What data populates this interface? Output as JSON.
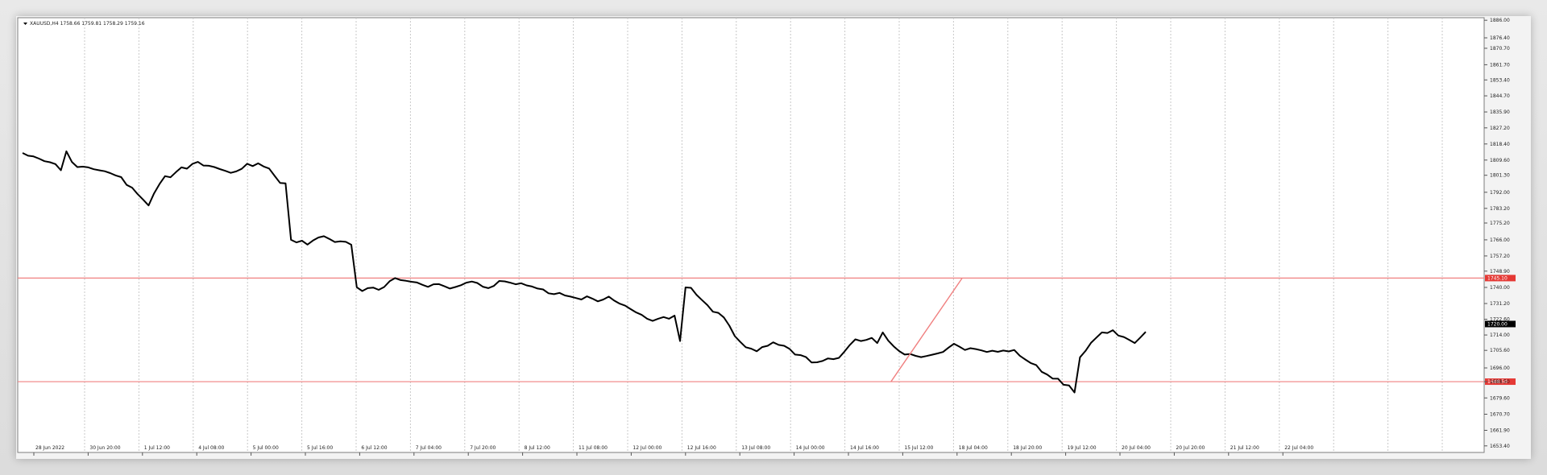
{
  "chart_data": {
    "type": "candlestick",
    "symbol_info": "XAUUSD,H4 1758.66 1759.81 1758.29 1759.16",
    "ylim": [
      1649.8,
      1887.4
    ],
    "y_tick_labels": [
      "1886.00",
      "1876.40",
      "1870.70",
      "1861.70",
      "1853.40",
      "1844.70",
      "1835.90",
      "1827.20",
      "1818.40",
      "1809.60",
      "1801.30",
      "1792.00",
      "1783.20",
      "1775.20",
      "1766.00",
      "1757.20",
      "1748.90",
      "1740.00",
      "1731.20",
      "1722.60",
      "1714.00",
      "1705.60",
      "1696.00",
      "1688.50",
      "1679.60",
      "1670.70",
      "1661.90",
      "1653.40"
    ],
    "x_tick_labels": [
      "28 Jun 2022",
      "30 Jun 20:00",
      "1 Jul 12:00",
      "4 Jul 08:00",
      "5 Jul 00:00",
      "5 Jul 16:00",
      "6 Jul 12:00",
      "7 Jul 04:00",
      "7 Jul 20:00",
      "8 Jul 12:00",
      "11 Jul 08:00",
      "12 Jul 00:00",
      "12 Jul 16:00",
      "13 Jul 08:00",
      "14 Jul 00:00",
      "14 Jul 16:00",
      "15 Jul 12:00",
      "18 Jul 04:00",
      "18 Jul 20:00",
      "19 Jul 12:00",
      "20 Jul 04:00",
      "20 Jul 20:00",
      "21 Jul 12:00",
      "22 Jul 04:00"
    ],
    "grid": true,
    "line_color": "#000000",
    "level_color": "#f08080",
    "tag_color": "#e53935",
    "current_tag_color": "#000000",
    "levels": [
      {
        "name": "upper",
        "price": 1745.1,
        "label": "1745.10"
      },
      {
        "name": "lower",
        "price": 1688.5,
        "label": "1688.50"
      }
    ],
    "current_price": {
      "price": 1720.0,
      "label": "1720.00"
    },
    "trendline": {
      "from": [
        158.5,
        1688.5
      ],
      "to": [
        171.5,
        1745.1
      ]
    },
    "series": [
      {
        "values": [
          1813.5,
          1812.0,
          1811.6,
          1810.4,
          1809.0,
          1808.4,
          1807.4,
          1804.0,
          1814.4,
          1808.6,
          1805.8,
          1806.0,
          1805.6,
          1804.6,
          1804.0,
          1803.5,
          1802.5,
          1801.2,
          1800.3,
          1796.0,
          1794.5,
          1791.0,
          1788.0,
          1784.8,
          1791.4,
          1796.5,
          1800.8,
          1800.2,
          1803.0,
          1805.6,
          1804.9,
          1807.5,
          1808.6,
          1806.6,
          1806.5,
          1805.8,
          1804.7,
          1803.7,
          1802.6,
          1803.4,
          1804.8,
          1807.6,
          1806.3,
          1807.8,
          1806.1,
          1805.0,
          1801.0,
          1797.1,
          1796.9,
          1766.0,
          1764.6,
          1765.5,
          1763.4,
          1765.6,
          1767.3,
          1768.0,
          1766.5,
          1764.8,
          1765.2,
          1764.9,
          1763.3,
          1740.1,
          1738.0,
          1739.6,
          1739.9,
          1738.7,
          1740.2,
          1743.4,
          1745.1,
          1744.0,
          1743.6,
          1743.1,
          1742.7,
          1741.4,
          1740.3,
          1741.7,
          1741.8,
          1740.6,
          1739.4,
          1740.2,
          1741.2,
          1742.6,
          1743.2,
          1742.4,
          1740.4,
          1739.6,
          1740.8,
          1743.5,
          1743.3,
          1742.6,
          1741.7,
          1742.3,
          1741.1,
          1740.5,
          1739.4,
          1738.9,
          1736.8,
          1736.3,
          1737.0,
          1735.6,
          1735.0,
          1734.2,
          1733.4,
          1735.1,
          1733.9,
          1732.4,
          1733.4,
          1735.0,
          1732.8,
          1731.1,
          1730.0,
          1728.1,
          1726.3,
          1725.0,
          1722.9,
          1721.7,
          1722.9,
          1723.8,
          1722.9,
          1724.6,
          1710.7,
          1740.0,
          1739.8,
          1736.0,
          1733.1,
          1730.3,
          1726.7,
          1726.1,
          1723.6,
          1719.1,
          1713.4,
          1710.2,
          1707.3,
          1706.5,
          1705.1,
          1707.4,
          1708.1,
          1710.0,
          1708.6,
          1708.1,
          1706.4,
          1703.3,
          1703.0,
          1701.9,
          1699.0,
          1699.1,
          1699.8,
          1701.2,
          1700.8,
          1701.5,
          1704.9,
          1708.6,
          1711.6,
          1710.7,
          1711.3,
          1712.4,
          1709.6,
          1715.4,
          1710.9,
          1707.8,
          1705.2,
          1703.3,
          1703.6,
          1702.6,
          1701.9,
          1702.5,
          1703.2,
          1703.9,
          1704.7,
          1707.1,
          1709.2,
          1707.6,
          1705.8,
          1706.8,
          1706.3,
          1705.6,
          1704.7,
          1705.4,
          1704.8,
          1705.5,
          1705.0,
          1705.8,
          1702.7,
          1700.6,
          1698.7,
          1697.6,
          1693.9,
          1692.4,
          1690.2,
          1690.1,
          1686.8,
          1686.4,
          1682.6,
          1701.8,
          1705.3,
          1709.7,
          1712.6,
          1715.4,
          1715.1,
          1716.6,
          1713.7,
          1712.9,
          1711.3,
          1709.6,
          1712.6,
          1715.7
        ]
      }
    ]
  }
}
